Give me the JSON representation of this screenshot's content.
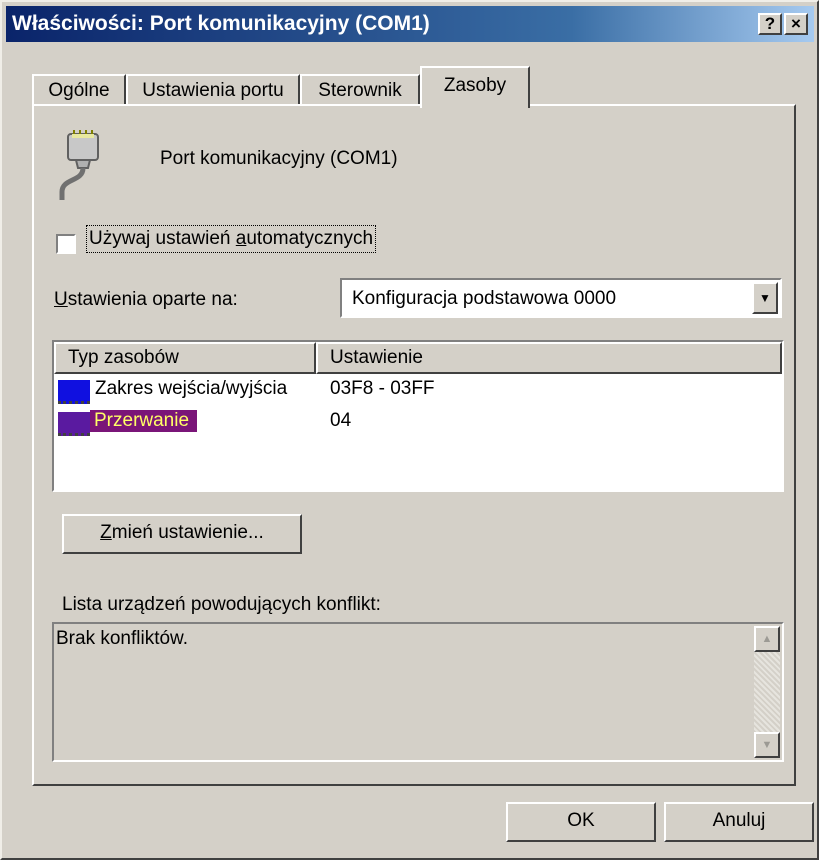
{
  "window": {
    "title": "Właściwości: Port komunikacyjny (COM1)",
    "help_button": "?",
    "close_button": "×"
  },
  "tabs": [
    {
      "label": "Ogólne",
      "active": false
    },
    {
      "label": "Ustawienia portu",
      "active": false
    },
    {
      "label": "Sterownik",
      "active": false
    },
    {
      "label": "Zasoby",
      "active": true
    }
  ],
  "device": {
    "icon": "serial-port-icon",
    "label": "Port komunikacyjny (COM1)"
  },
  "auto_settings": {
    "checked": false,
    "label_prefix": "Używaj ustawień ",
    "label_accel": "a",
    "label_suffix": "utomatycznych"
  },
  "settings_based_on": {
    "label_accel": "U",
    "label_rest": "stawienia oparte na:",
    "selected": "Konfiguracja podstawowa 0000"
  },
  "resources": {
    "columns": [
      "Typ zasobów",
      "Ustawienie"
    ],
    "rows": [
      {
        "type": "Zakres wejścia/wyjścia",
        "setting": "03F8 - 03FF",
        "selected": false
      },
      {
        "type": "Przerwanie",
        "setting": "04",
        "selected": true
      }
    ]
  },
  "change_button": {
    "accel": "Z",
    "rest": "mień ustawienie..."
  },
  "conflicts": {
    "label": "Lista urządzeń powodujących konflikt:",
    "text": "Brak konfliktów."
  },
  "footer": {
    "ok": "OK",
    "cancel": "Anuluj"
  },
  "colors": {
    "titlebar": "#0a246a",
    "selection": "#7a1578",
    "selection_text": "#ffff66",
    "face": "#d4d0c8"
  }
}
